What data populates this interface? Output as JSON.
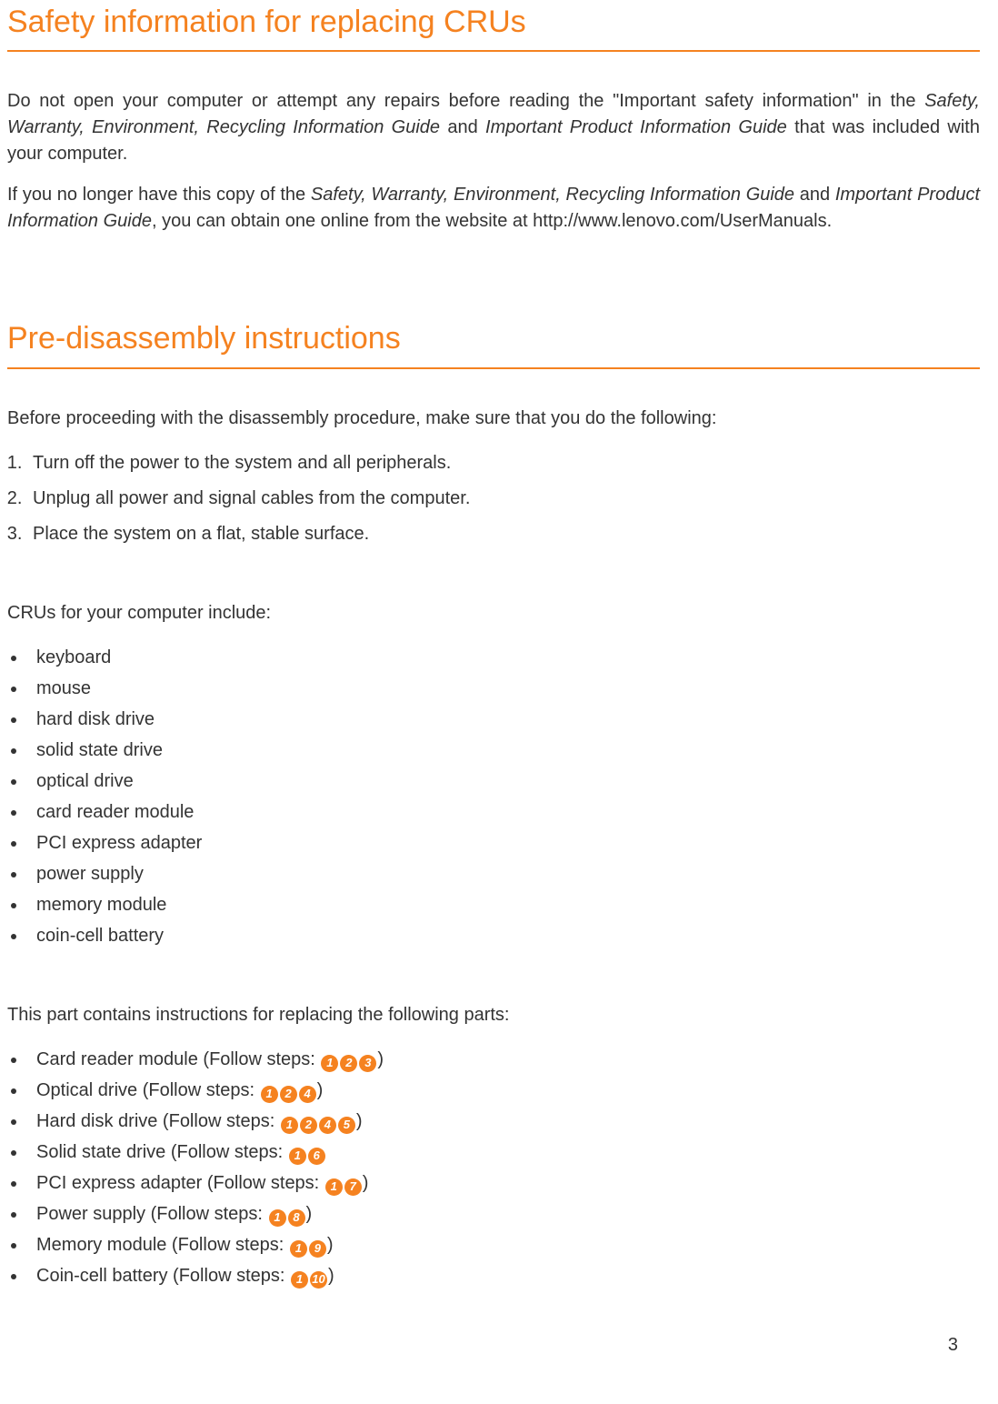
{
  "heading1": "Safety information for replacing CRUs",
  "heading2": "Pre-disassembly instructions",
  "para1": {
    "lead": "Do not open your computer or attempt any repairs before reading the \"Important safety information\" in the ",
    "em1": "Safety, Warranty, Environment, Recycling Information Guide",
    "mid1": " and ",
    "em2": "Important Product Information Guide",
    "tail": " that was included with your computer."
  },
  "para2": {
    "lead": "If you no longer have this copy of the ",
    "em1": "Safety, Warranty, Environment, Recycling Information Guide",
    "mid1": " and ",
    "em2": "Important Product Information Guide",
    "tail": ", you can obtain one online from the website at http://www.lenovo.com/UserManuals."
  },
  "pre_intro": "Before proceeding with the disassembly procedure, make sure that you do the following:",
  "pre_steps": [
    "Turn off the power to the system and all peripherals.",
    "Unplug all power and signal cables from the computer.",
    "Place the system on a flat, stable surface."
  ],
  "cru_intro": "CRUs for your computer include:",
  "cru_list": [
    "keyboard",
    "mouse",
    "hard disk drive",
    "solid state drive",
    "optical drive",
    "card reader module",
    "PCI express adapter",
    "power supply",
    "memory module",
    "coin-cell battery"
  ],
  "replace_intro": "This part contains instructions for replacing the following parts:",
  "replace_list": [
    {
      "label": "Card reader module (Follow steps:",
      "steps": [
        "1",
        "2",
        "3"
      ],
      "close": ")"
    },
    {
      "label": "Optical drive (Follow steps:",
      "steps": [
        "1",
        "2",
        "4"
      ],
      "close": ")"
    },
    {
      "label": "Hard disk drive (Follow steps:",
      "steps": [
        "1",
        "2",
        "4",
        "5"
      ],
      "close": ")"
    },
    {
      "label": "Solid state drive (Follow steps:",
      "steps": [
        "1",
        "6"
      ],
      "close": ""
    },
    {
      "label": "PCI express adapter (Follow steps:",
      "steps": [
        "1",
        "7"
      ],
      "close": ")"
    },
    {
      "label": "Power supply (Follow steps:",
      "steps": [
        "1",
        "8"
      ],
      "close": ")"
    },
    {
      "label": "Memory module (Follow steps:",
      "steps": [
        "1",
        "9"
      ],
      "close": ")"
    },
    {
      "label": "Coin-cell battery (Follow steps:",
      "steps": [
        "1",
        "10"
      ],
      "close": ")"
    }
  ],
  "page_number": "3"
}
